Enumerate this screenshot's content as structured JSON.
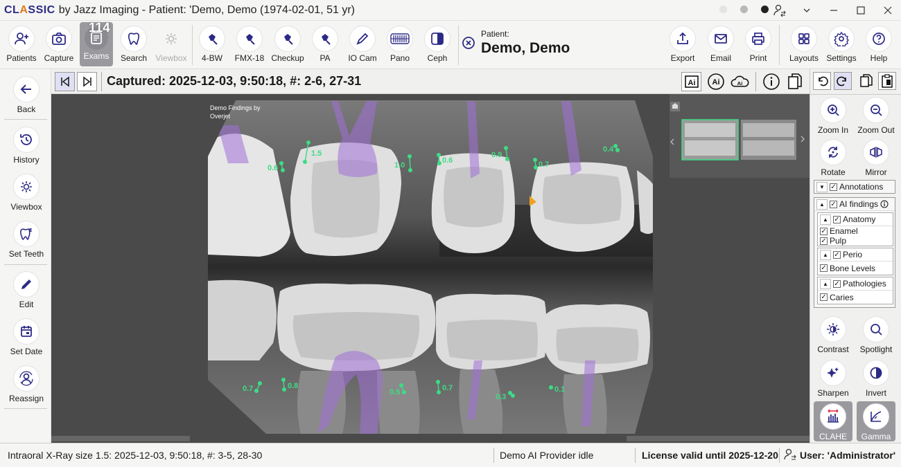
{
  "app": {
    "brand_pre": "CL",
    "brand_mid": "A",
    "brand_post": "SSIC",
    "title": "by Jazz Imaging - Patient: 'Demo, Demo (1974-02-01, 51 yr)"
  },
  "toolbar": {
    "exams_badge": "114",
    "items": [
      {
        "label": "Patients",
        "icon": "add-user-icon"
      },
      {
        "label": "Capture",
        "icon": "camera-icon"
      },
      {
        "label": "Exams",
        "icon": "document-icon"
      },
      {
        "label": "Search",
        "icon": "tooth-icon"
      },
      {
        "label": "Viewbox",
        "icon": "sun-icon"
      },
      {
        "label": "4-BW",
        "icon": "sensor-icon"
      },
      {
        "label": "FMX-18",
        "icon": "sensor-icon"
      },
      {
        "label": "Checkup",
        "icon": "sensor-icon"
      },
      {
        "label": "PA",
        "icon": "sensor-icon"
      },
      {
        "label": "IO Cam",
        "icon": "pen-icon"
      },
      {
        "label": "Pano",
        "icon": "pano-icon"
      },
      {
        "label": "Ceph",
        "icon": "ceph-icon"
      }
    ],
    "patient_label": "Patient:",
    "patient_name": "Demo, Demo",
    "right_items": [
      {
        "label": "Export",
        "icon": "upload-icon"
      },
      {
        "label": "Email",
        "icon": "mail-icon"
      },
      {
        "label": "Print",
        "icon": "printer-icon"
      },
      {
        "label": "Layouts",
        "icon": "grid-icon"
      },
      {
        "label": "Settings",
        "icon": "gear-icon"
      },
      {
        "label": "Help",
        "icon": "help-icon"
      }
    ]
  },
  "sidebar": {
    "items": [
      {
        "label": "Back",
        "icon": "arrow-left-icon"
      },
      {
        "label": "History",
        "icon": "history-icon"
      },
      {
        "label": "Viewbox",
        "icon": "sun-icon"
      },
      {
        "label": "Set Teeth",
        "icon": "tooth-icon"
      },
      {
        "label": "Edit",
        "icon": "pencil-icon"
      },
      {
        "label": "Set Date",
        "icon": "calendar-icon"
      },
      {
        "label": "Reassign",
        "icon": "reassign-icon"
      }
    ]
  },
  "image_bar": {
    "captured": "Captured: 2025-12-03, 9:50:18, #: 2-6, 27-31",
    "ai_buttons": [
      "Ai",
      "Ai",
      "Ai"
    ]
  },
  "viewer": {
    "overlay_line1": "Demo Findings by",
    "overlay_line2": "Overjet",
    "measurements": [
      "0.6",
      "1.5",
      "1.0",
      "0.6",
      "0.9",
      "0.7",
      "0.4",
      "0.7",
      "0.8",
      "0.5",
      "0.7",
      "0.3",
      "0.1"
    ],
    "colors": {
      "bone_marker": "#3ddc84",
      "pulp": "#a070d8",
      "caries": "#f0a020"
    }
  },
  "tools": {
    "items": [
      {
        "label": "Zoom In",
        "icon": "zoom-in-icon"
      },
      {
        "label": "Zoom Out",
        "icon": "zoom-out-icon"
      },
      {
        "label": "Rotate",
        "icon": "rotate-icon"
      },
      {
        "label": "Mirror",
        "icon": "mirror-icon"
      },
      {
        "label": "Contrast",
        "icon": "contrast-icon"
      },
      {
        "label": "Spotlight",
        "icon": "search-icon"
      },
      {
        "label": "Sharpen",
        "icon": "sparkle-icon"
      },
      {
        "label": "Invert",
        "icon": "invert-icon"
      },
      {
        "label": "CLAHE",
        "icon": "clahe-icon"
      },
      {
        "label": "Gamma",
        "icon": "gamma-icon"
      }
    ]
  },
  "layers": {
    "annotations": "Annotations",
    "ai_findings": "AI findings",
    "anatomy": "Anatomy",
    "enamel": "Enamel",
    "pulp": "Pulp",
    "perio": "Perio",
    "bone_levels": "Bone Levels",
    "pathologies": "Pathologies",
    "caries": "Caries"
  },
  "status": {
    "image_info": "Intraoral X-Ray size 1.5: 2025-12-03, 9:50:18, #: 3-5, 28-30",
    "ai_status": "Demo AI Provider idle",
    "license": "License valid until 2025-12-20",
    "user": "User: 'Administrator'"
  }
}
